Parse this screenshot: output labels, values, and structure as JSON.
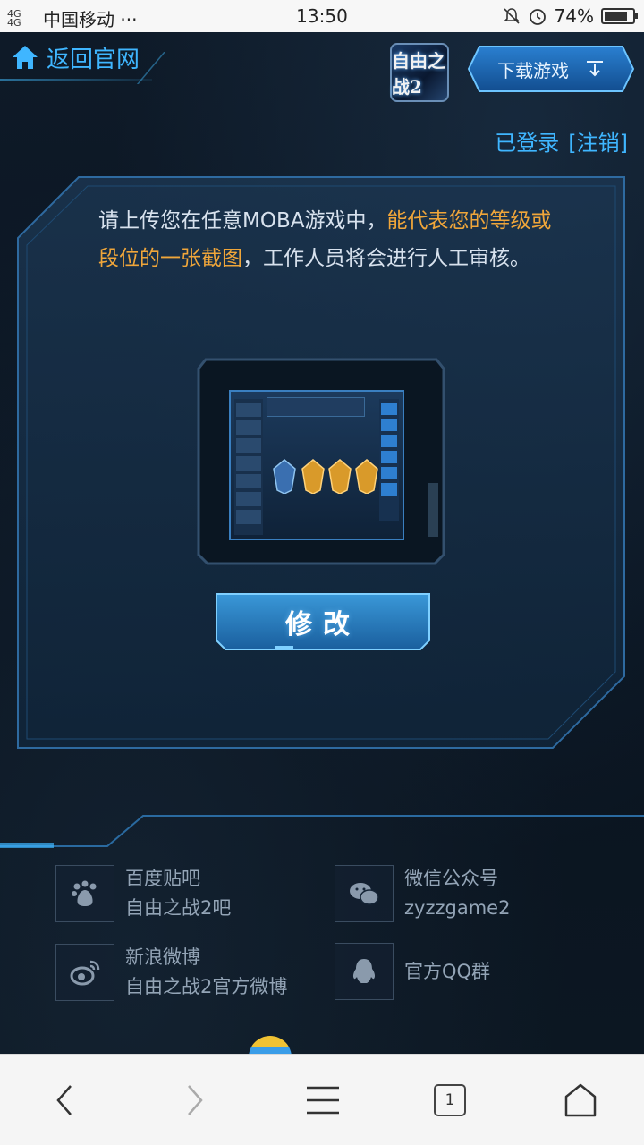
{
  "status_bar": {
    "network": "4G 4G",
    "carrier": "中国移动 ···",
    "time": "13:50",
    "battery": "74%",
    "battery_level": 0.74
  },
  "header": {
    "back_label": "返回官网",
    "logo_text": "自由之战2",
    "download_label": "下载游戏"
  },
  "login": {
    "status": "已登录",
    "logout": "[注销]"
  },
  "panel": {
    "intro_part1": "请上传您在任意MOBA游戏中，",
    "intro_highlight": "能代表您的等级或段位的一张截图",
    "intro_part2": "，工作人员将会进行人工审核。",
    "modify_label": "修改"
  },
  "links": [
    {
      "icon": "baidu-paw-icon",
      "title": "百度贴吧",
      "subtitle": "自由之战2吧"
    },
    {
      "icon": "wechat-icon",
      "title": "微信公众号",
      "subtitle": "zyzzgame2"
    },
    {
      "icon": "weibo-icon",
      "title": "新浪微博",
      "subtitle": "自由之战2官方微博"
    },
    {
      "icon": "qq-icon",
      "title": "官方QQ群",
      "subtitle": ""
    }
  ],
  "browser": {
    "tab_count": "1"
  },
  "colors": {
    "accent_blue": "#3fb6ff",
    "highlight_orange": "#f0a63a",
    "background": "#0b1624"
  }
}
